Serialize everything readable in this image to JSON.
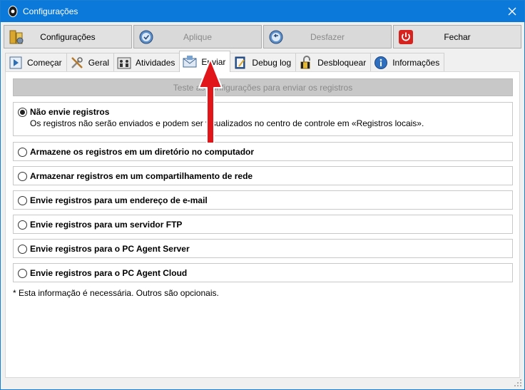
{
  "window": {
    "title": "Configurações"
  },
  "toolbar": {
    "buttons": [
      {
        "label": "Configurações",
        "icon": "settings-icon",
        "enabled": true
      },
      {
        "label": "Aplique",
        "icon": "clock-check-icon",
        "enabled": false
      },
      {
        "label": "Desfazer",
        "icon": "undo-clock-icon",
        "enabled": false
      },
      {
        "label": "Fechar",
        "icon": "power-icon",
        "enabled": true
      }
    ]
  },
  "tabs": [
    {
      "label": "Começar",
      "icon": "play-icon"
    },
    {
      "label": "Geral",
      "icon": "tools-icon"
    },
    {
      "label": "Atividades",
      "icon": "people-icon"
    },
    {
      "label": "Enviar",
      "icon": "envelope-icon",
      "active": true
    },
    {
      "label": "Debug log",
      "icon": "notebook-icon"
    },
    {
      "label": "Desbloquear",
      "icon": "padlock-icon"
    },
    {
      "label": "Informações",
      "icon": "info-icon"
    }
  ],
  "main": {
    "test_button": "Teste as configurações para enviar os registros",
    "options": [
      {
        "label": "Não envie registros",
        "selected": true,
        "description": "Os registros não serão enviados e podem ser visualizados no centro de controle em «Registros locais»."
      },
      {
        "label": "Armazene os registros em um diretório no computador",
        "selected": false
      },
      {
        "label": "Armazenar registros em um compartilhamento de rede",
        "selected": false
      },
      {
        "label": "Envie registros para um endereço de e-mail",
        "selected": false
      },
      {
        "label": "Envie registros para um servidor FTP",
        "selected": false
      },
      {
        "label": "Envie registros para o PC Agent Server",
        "selected": false
      },
      {
        "label": "Envie registros para o PC Agent Cloud",
        "selected": false
      }
    ],
    "footnote": "* Esta informação é necessária. Outros são opcionais."
  },
  "colors": {
    "titlebar": "#0b79d9",
    "annotation_arrow": "#e0161b",
    "panel": "#ffffff"
  }
}
